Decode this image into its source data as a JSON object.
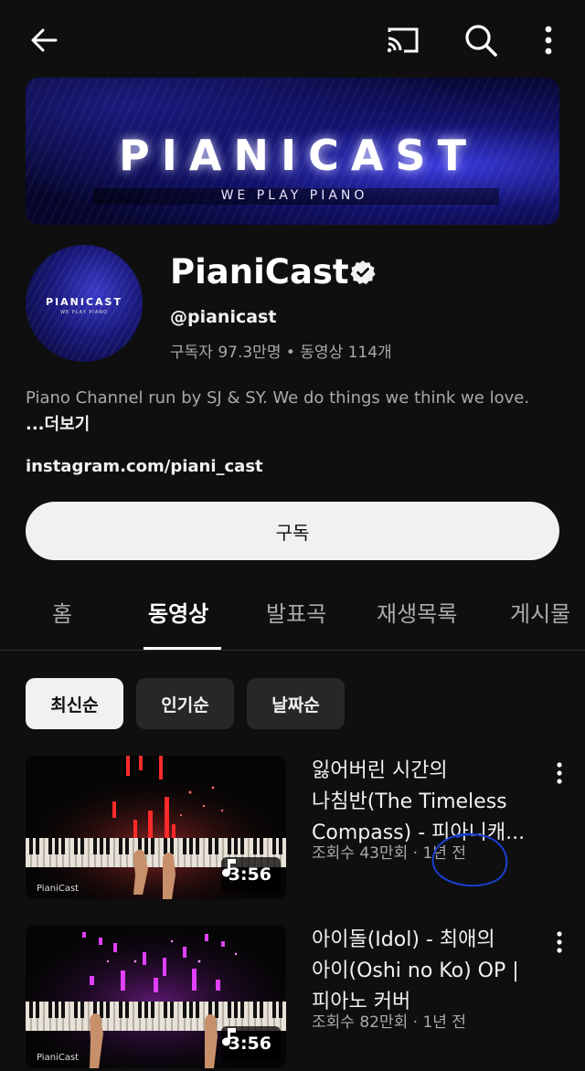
{
  "header": {
    "back_icon": "arrow-left-icon",
    "cast_icon": "cast-icon",
    "search_icon": "search-icon",
    "more_icon": "more-vertical-icon"
  },
  "banner": {
    "title": "PIANICAST",
    "tagline": "WE PLAY PIANO"
  },
  "avatar": {
    "title": "PIANICAST",
    "tagline": "WE PLAY PIANO"
  },
  "channel": {
    "name": "PianiCast",
    "verified_icon": "verified-badge-icon",
    "handle": "@pianicast",
    "stats": "구독자 97.3만명 • 동영상 114개",
    "description": "Piano Channel run by SJ & SY. We do things we think we love. ",
    "more_label": "...더보기",
    "link": "instagram.com/piani_cast",
    "subscribe_label": "구독"
  },
  "tabs": [
    {
      "label": "홈",
      "active": false
    },
    {
      "label": "동영상",
      "active": true
    },
    {
      "label": "발표곡",
      "active": false
    },
    {
      "label": "재생목록",
      "active": false
    },
    {
      "label": "게시물",
      "active": false
    }
  ],
  "chips": [
    {
      "label": "최신순",
      "active": true
    },
    {
      "label": "인기순",
      "active": false
    },
    {
      "label": "날짜순",
      "active": false
    }
  ],
  "videos": [
    {
      "title_lines": [
        "잃어버린 시간의",
        "나침반(The Timeless",
        "Compass) - 피아니캐..."
      ],
      "meta": "조회수 43만회 · 1년 전",
      "duration": "3:56",
      "duration_icon": "music-note-icon",
      "watermark": "PianiCast",
      "accent": "#ff3a3a"
    },
    {
      "title_lines": [
        "아이돌(Idol) - 최애의",
        "아이(Oshi no Ko) OP |",
        "피아노 커버"
      ],
      "meta": "조회수 82만회 · 1년 전",
      "duration": "3:56",
      "duration_icon": "music-note-icon",
      "watermark": "PianiCast",
      "accent": "#e040ff"
    }
  ],
  "colors": {
    "background": "#0f0f0f",
    "text_primary": "#f1f1f1",
    "text_secondary": "#aaaaaa",
    "chip_bg": "#272727",
    "annotation": "#1a3fd0"
  }
}
